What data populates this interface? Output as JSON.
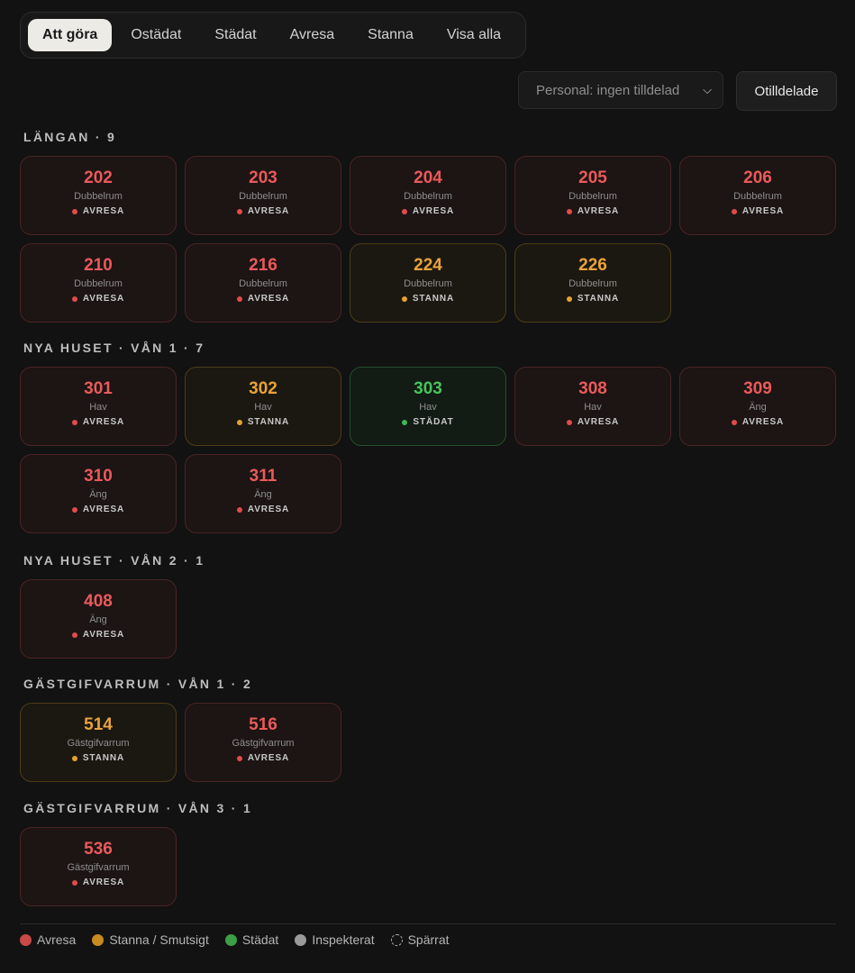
{
  "tabs": [
    {
      "label": "Att göra",
      "active": true
    },
    {
      "label": "Ostädat",
      "active": false
    },
    {
      "label": "Städat",
      "active": false
    },
    {
      "label": "Avresa",
      "active": false
    },
    {
      "label": "Stanna",
      "active": false
    },
    {
      "label": "Visa alla",
      "active": false
    }
  ],
  "staff_filter": {
    "selected": "Personal: ingen tilldelad",
    "icon": "chevron-down-icon"
  },
  "unassigned_button": "Otilldelade",
  "sections": [
    {
      "title": "LÄNGAN · 9",
      "rooms": [
        {
          "number": "202",
          "type": "Dubbelrum",
          "status": "AVRESA",
          "kind": "avresa"
        },
        {
          "number": "203",
          "type": "Dubbelrum",
          "status": "AVRESA",
          "kind": "avresa"
        },
        {
          "number": "204",
          "type": "Dubbelrum",
          "status": "AVRESA",
          "kind": "avresa"
        },
        {
          "number": "205",
          "type": "Dubbelrum",
          "status": "AVRESA",
          "kind": "avresa"
        },
        {
          "number": "206",
          "type": "Dubbelrum",
          "status": "AVRESA",
          "kind": "avresa"
        },
        {
          "number": "210",
          "type": "Dubbelrum",
          "status": "AVRESA",
          "kind": "avresa"
        },
        {
          "number": "216",
          "type": "Dubbelrum",
          "status": "AVRESA",
          "kind": "avresa"
        },
        {
          "number": "224",
          "type": "Dubbelrum",
          "status": "STANNA",
          "kind": "stanna"
        },
        {
          "number": "226",
          "type": "Dubbelrum",
          "status": "STANNA",
          "kind": "stanna"
        }
      ]
    },
    {
      "title": "NYA HUSET · VÅN 1 · 7",
      "rooms": [
        {
          "number": "301",
          "type": "Hav",
          "status": "AVRESA",
          "kind": "avresa"
        },
        {
          "number": "302",
          "type": "Hav",
          "status": "STANNA",
          "kind": "stanna"
        },
        {
          "number": "303",
          "type": "Hav",
          "status": "STÄDAT",
          "kind": "stadat"
        },
        {
          "number": "308",
          "type": "Hav",
          "status": "AVRESA",
          "kind": "avresa"
        },
        {
          "number": "309",
          "type": "Äng",
          "status": "AVRESA",
          "kind": "avresa"
        },
        {
          "number": "310",
          "type": "Äng",
          "status": "AVRESA",
          "kind": "avresa"
        },
        {
          "number": "311",
          "type": "Äng",
          "status": "AVRESA",
          "kind": "avresa"
        }
      ]
    },
    {
      "title": "NYA HUSET · VÅN 2 · 1",
      "rooms": [
        {
          "number": "408",
          "type": "Äng",
          "status": "AVRESA",
          "kind": "avresa"
        }
      ]
    },
    {
      "title": "GÄSTGIFVARRUM · VÅN 1 · 2",
      "rooms": [
        {
          "number": "514",
          "type": "Gästgifvarrum",
          "status": "STANNA",
          "kind": "stanna"
        },
        {
          "number": "516",
          "type": "Gästgifvarrum",
          "status": "AVRESA",
          "kind": "avresa"
        }
      ]
    },
    {
      "title": "GÄSTGIFVARRUM · VÅN 3 · 1",
      "rooms": [
        {
          "number": "536",
          "type": "Gästgifvarrum",
          "status": "AVRESA",
          "kind": "avresa"
        }
      ]
    }
  ],
  "legend": [
    {
      "label": "Avresa",
      "color": "#c94848",
      "style": "solid"
    },
    {
      "label": "Stanna / Smutsigt",
      "color": "#c98a1f",
      "style": "solid"
    },
    {
      "label": "Städat",
      "color": "#3c9f45",
      "style": "solid"
    },
    {
      "label": "Inspekterat",
      "color": "#9a9a9a",
      "style": "solid"
    },
    {
      "label": "Spärrat",
      "color": "#aaaaaa",
      "style": "dashed"
    }
  ]
}
